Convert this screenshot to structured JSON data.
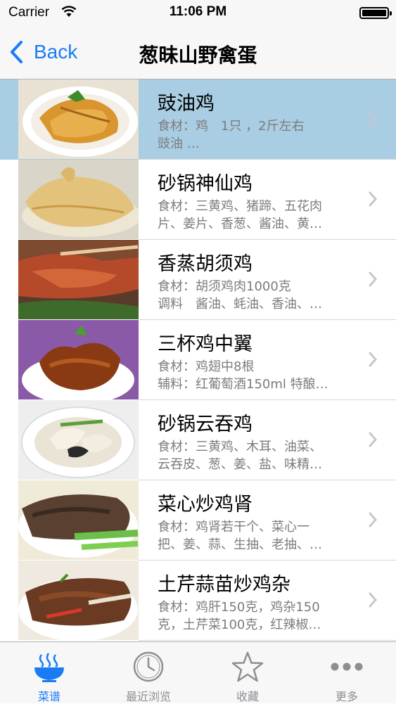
{
  "status_bar": {
    "carrier": "Carrier",
    "time": "11:06 PM"
  },
  "nav": {
    "back_label": "Back",
    "title": "葱昧山野禽蛋"
  },
  "recipes": [
    {
      "title": "豉油鸡",
      "line1": "食材：鸡　1只 ，2斤左右",
      "line2": "豉油 …",
      "selected": true
    },
    {
      "title": "砂锅神仙鸡",
      "line1": "食材：三黄鸡、猪蹄、五花肉",
      "line2": "片、姜片、香葱、酱油、黄…"
    },
    {
      "title": "香蒸胡须鸡",
      "line1": "食材：胡须鸡肉1000克",
      "line2": "调料　酱油、蚝油、香油、…"
    },
    {
      "title": "三杯鸡中翼",
      "line1": "食材：鸡翅中8根",
      "line2": "辅料：红葡萄酒150ml 特酿…"
    },
    {
      "title": "砂锅云吞鸡",
      "line1": "食材：三黄鸡、木耳、油菜、",
      "line2": "云吞皮、葱、姜、盐、味精…"
    },
    {
      "title": "菜心炒鸡肾",
      "line1": "食材：鸡肾若干个、菜心一",
      "line2": "把、姜、蒜、生抽、老抽、…"
    },
    {
      "title": "土芹蒜苗炒鸡杂",
      "line1": "食材：鸡肝150克，鸡杂150",
      "line2": "克，土芹菜100克，红辣椒…"
    }
  ],
  "tabs": [
    {
      "label": "菜谱",
      "icon": "bowl-icon",
      "active": true
    },
    {
      "label": "最近浏览",
      "icon": "clock-icon"
    },
    {
      "label": "收藏",
      "icon": "star-icon"
    },
    {
      "label": "更多",
      "icon": "more-dots-icon"
    }
  ],
  "colors": {
    "accent": "#1a7cf5",
    "selected_row": "#a9cde2",
    "inactive_tab": "#8e8e93"
  }
}
